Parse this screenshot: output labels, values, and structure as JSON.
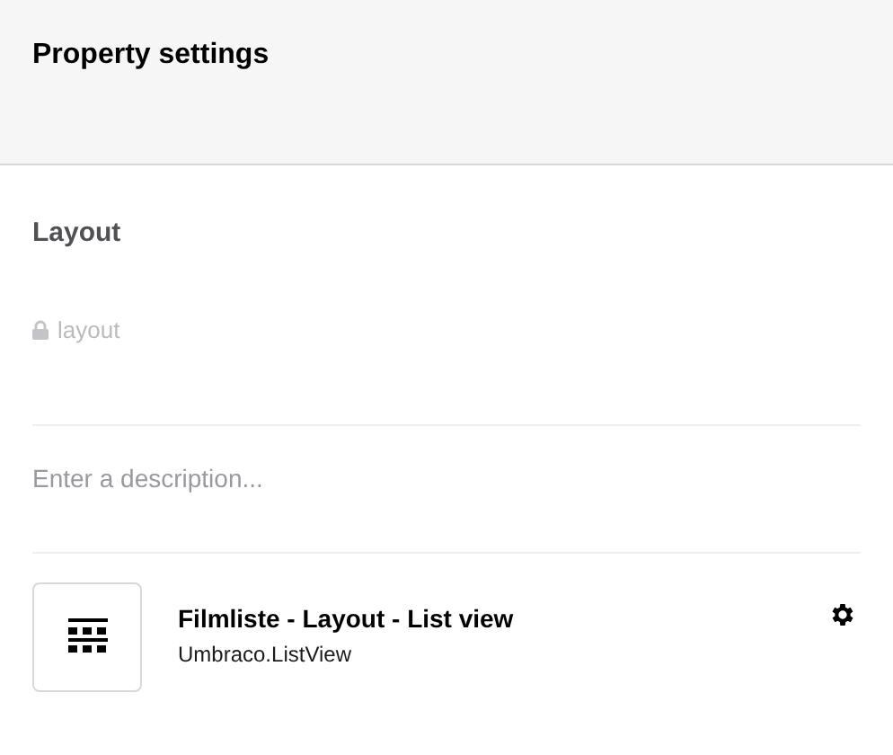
{
  "header": {
    "title": "Property settings"
  },
  "property": {
    "name": "Layout",
    "alias": "layout",
    "alias_locked": true
  },
  "description": {
    "placeholder": "Enter a description..."
  },
  "editor": {
    "name": "Filmliste - Layout - List view",
    "alias": "Umbraco.ListView"
  }
}
